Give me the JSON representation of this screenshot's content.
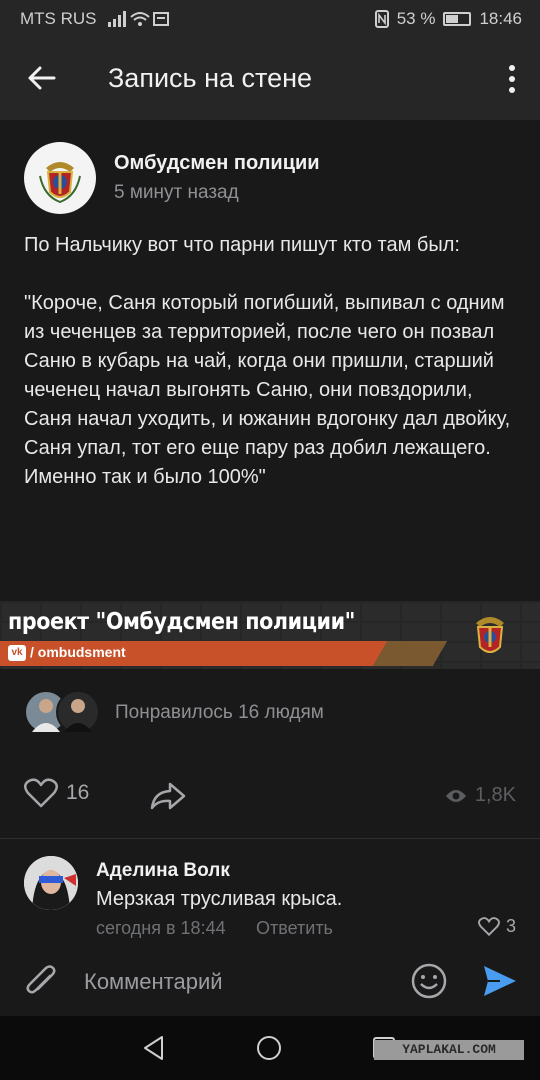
{
  "status_bar": {
    "carrier": "MTS RUS",
    "battery": "53 %",
    "battery_level": 0.53,
    "time": "18:46"
  },
  "header": {
    "title": "Запись на стене",
    "back_icon": "arrow-left-icon",
    "menu_icon": "more-vertical-icon"
  },
  "post": {
    "author": "Омбудсмен полиции",
    "time": "5 минут назад",
    "text": "По Нальчику вот что парни пишут кто там был:\n\n\"Короче, Саня который погибший, выпивал с одним из чеченцев за территорией, после чего он позвал Саню в кубарь на чай, когда они пришли, старший чеченец начал выгонять Саню, они повздорили, Саня начал уходить, и южанин вдогонку дал двойку, Саня упал, тот его еще пару раз добил лежащего. Именно так и было 100%\""
  },
  "banner": {
    "headline": "проект \"Омбудсмен полиции\"",
    "vk_logo": "vk",
    "handle": "/ ombudsment",
    "accent_color": "#c8512a"
  },
  "likes": {
    "liked_by": "Понравилось 16 людям",
    "count": "16",
    "views": "1,8K"
  },
  "comment": {
    "author": "Аделина Волк",
    "text": "Мерзкая трусливая крыса.",
    "time": "сегодня в 18:44",
    "reply": "Ответить",
    "likes": "3"
  },
  "composer": {
    "placeholder": "Комментарий"
  },
  "watermark": "YAPLAKAL.COM"
}
